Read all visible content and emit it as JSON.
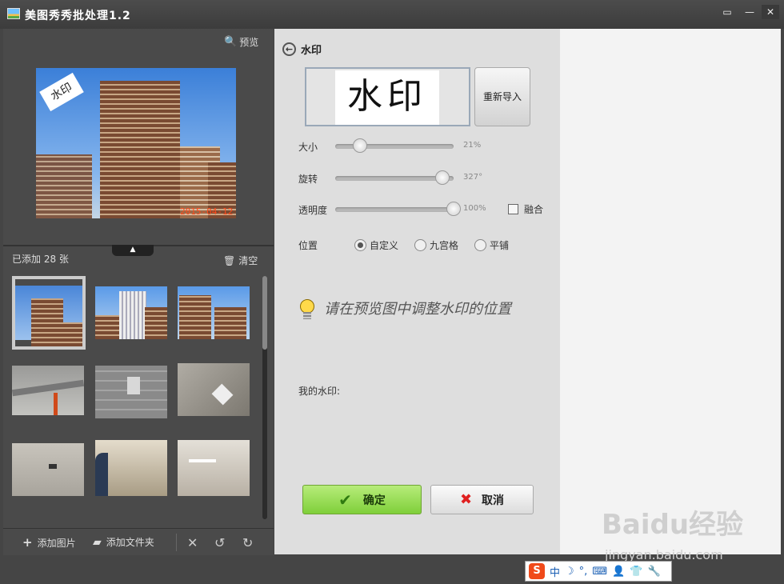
{
  "window": {
    "title": "美图秀秀批处理1.2",
    "controls": [
      "▭",
      "—",
      "✕"
    ]
  },
  "left_panel": {
    "preview_label": "预览",
    "preview_image": {
      "watermark_text": "水印",
      "date_stamp": "2015-04-12"
    },
    "added_count": "已添加 28 张",
    "clear_label": "清空",
    "expand_glyph": "▲",
    "bottom_bar": {
      "add_image": "添加图片",
      "add_folder": "添加文件夹",
      "icons": [
        "close-icon",
        "rotate-left-icon",
        "rotate-right-icon"
      ]
    }
  },
  "settings": {
    "title": "水印",
    "watermark_preview_text": "水印",
    "reimport_label": "重新导入",
    "size": {
      "label": "大小",
      "value_text": "21%",
      "value": 0.21
    },
    "rotation": {
      "label": "旋转",
      "value_text": "327°",
      "value": 0.908
    },
    "opacity": {
      "label": "透明度",
      "value_text": "100%",
      "value": 1.0
    },
    "blend": {
      "label": "融合",
      "checked": false
    },
    "position": {
      "label": "位置",
      "options": [
        "自定义",
        "九宫格",
        "平铺"
      ],
      "selected": "自定义"
    },
    "hint": "请在预览图中调整水印的位置",
    "my_watermark_label": "我的水印:",
    "ok_label": "确定",
    "cancel_label": "取消"
  },
  "overlays": {
    "watermark_brand": "Baidu经验",
    "watermark_url": "jingyan.baidu.com",
    "ime": [
      "S",
      "中",
      "☽",
      "°,",
      "⌨",
      "👤",
      "👕",
      "🔧"
    ]
  },
  "colors": {
    "ok_green": "#7fcf3a",
    "date_stamp": "#ff4a1a",
    "ime_logo": "#f04a1a"
  }
}
